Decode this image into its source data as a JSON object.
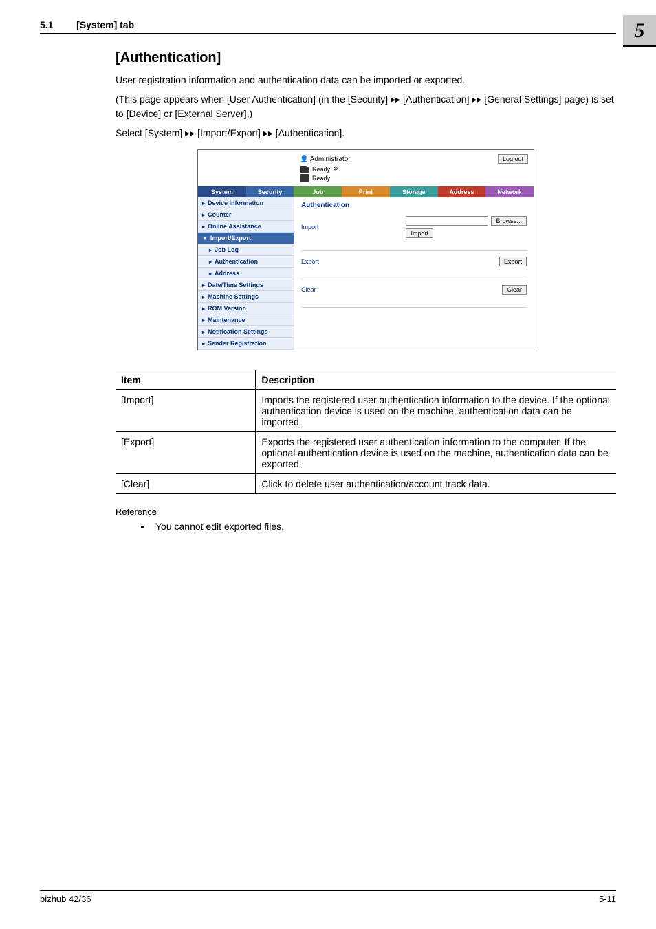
{
  "header": {
    "section_number": "5.1",
    "section_title": "[System] tab",
    "chapter_number": "5"
  },
  "page": {
    "title": "[Authentication]",
    "para1": "User registration information and authentication data can be imported or exported.",
    "para2_a": "(This page appears when [User Authentication] (in the [Security] ",
    "para2_b": " [Authentication] ",
    "para2_c": " [General Settings] page) is set to [Device] or [External Server].)",
    "arrow": "▸▸",
    "para3_a": "Select [System] ",
    "para3_b": " [Import/Export] ",
    "para3_c": " [Authentication]."
  },
  "ui": {
    "admin_label": "Administrator",
    "logout": "Log out",
    "ready": "Ready",
    "refresh_icon": "↻",
    "tabs": [
      "System",
      "Security",
      "Job",
      "Print",
      "Storage",
      "Address",
      "Network"
    ],
    "nav": [
      {
        "label": "Device Information",
        "tri": "▸"
      },
      {
        "label": "Counter",
        "tri": "▸"
      },
      {
        "label": "Online Assistance",
        "tri": "▸"
      },
      {
        "label": "Import/Export",
        "tri": "▼",
        "open": true
      },
      {
        "label": "Job Log",
        "tri": "▸",
        "sub": true
      },
      {
        "label": "Authentication",
        "tri": "▸",
        "sub": true
      },
      {
        "label": "Address",
        "tri": "▸",
        "sub": true
      },
      {
        "label": "Date/Time Settings",
        "tri": "▸"
      },
      {
        "label": "Machine Settings",
        "tri": "▸"
      },
      {
        "label": "ROM Version",
        "tri": "▸"
      },
      {
        "label": "Maintenance",
        "tri": "▸"
      },
      {
        "label": "Notification Settings",
        "tri": "▸"
      },
      {
        "label": "Sender Registration",
        "tri": "▸"
      }
    ],
    "main_heading": "Authentication",
    "import_label": "Import",
    "export_label": "Export",
    "clear_label": "Clear",
    "browse": "Browse...",
    "import_btn": "Import",
    "export_btn": "Export",
    "clear_btn": "Clear"
  },
  "table": {
    "head_item": "Item",
    "head_desc": "Description",
    "rows": [
      {
        "item": "[Import]",
        "desc": "Imports the registered user authentication information to the device. If the optional authentication device is used on the machine, authentication data can be imported."
      },
      {
        "item": "[Export]",
        "desc": "Exports the registered user authentication information to the computer. If the optional authentication device is used on the machine, authentication data can be exported."
      },
      {
        "item": "[Clear]",
        "desc": "Click to delete user authentication/account track data."
      }
    ]
  },
  "reference": {
    "label": "Reference",
    "bullet1": "You cannot edit exported files."
  },
  "footer": {
    "model": "bizhub 42/36",
    "page": "5-11"
  }
}
